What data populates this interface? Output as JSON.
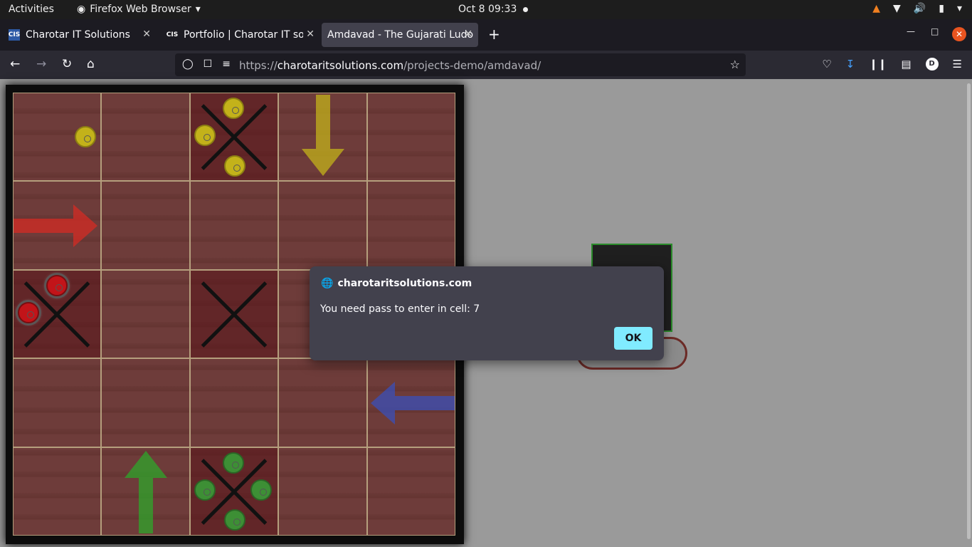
{
  "system_bar": {
    "activities": "Activities",
    "app_name": "Firefox Web Browser",
    "clock": "Oct 8  09:33"
  },
  "tabs": [
    {
      "label": "Charotar IT Solutions",
      "favicon": "CIS"
    },
    {
      "label": "Portfolio | Charotar IT sol",
      "favicon": "CIS"
    },
    {
      "label": "Amdavad - The Gujarati Ludo",
      "favicon": ""
    }
  ],
  "url": {
    "prefix": "https://",
    "domain": "charotaritsolutions.com",
    "path": "/projects-demo/amdavad/"
  },
  "toolbar": {
    "profile_initial": "D"
  },
  "dialog": {
    "origin": "charotaritsolutions.com",
    "message": "You need pass to enter in cell: 7",
    "ok_label": "OK"
  },
  "colors": {
    "accent": "#80ebff",
    "close_button": "#e95420",
    "pawn_yellow": "#c3b21a",
    "pawn_green": "#3d8f35",
    "pawn_red": "#c21419",
    "arrow_blue": "#3a4fb8"
  }
}
